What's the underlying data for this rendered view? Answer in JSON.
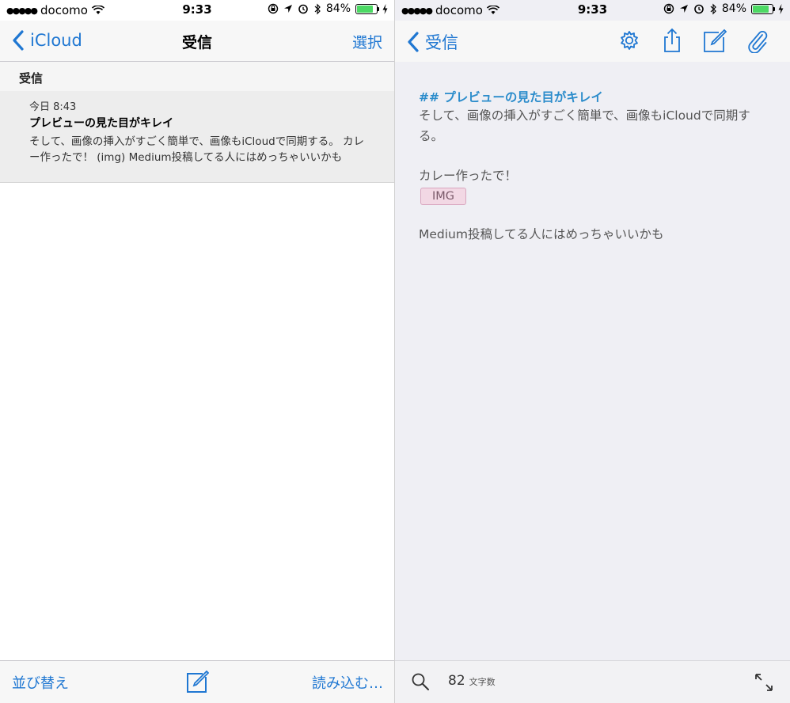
{
  "status": {
    "signal": "●●●●●",
    "carrier": "docomo",
    "time": "9:33",
    "battery": "84%",
    "battery_level": 0.84
  },
  "left": {
    "nav": {
      "back_label": "iCloud",
      "title": "受信",
      "action": "選択"
    },
    "section": "受信",
    "message": {
      "date": "今日 8:43",
      "title": "プレビューの見た目がキレイ",
      "preview": "そして、画像の挿入がすごく簡単で、画像もiCloudで同期する。 カレー作ったで！ (img) Medium投稿してる人にはめっちゃいいかも"
    },
    "bottom": {
      "sort": "並び替え",
      "load": "読み込む…"
    }
  },
  "right": {
    "nav": {
      "back_label": "受信"
    },
    "editor": {
      "heading": "## プレビューの見た目がキレイ",
      "line1": "そして、画像の挿入がすごく簡単で、画像もiCloudで同期す",
      "line2": "る。",
      "line3": "カレー作ったで！",
      "img": "IMG",
      "line4": "Medium投稿してる人にはめっちゃいいかも"
    },
    "bottom": {
      "count": "82",
      "count_label": "文字数"
    }
  },
  "colors": {
    "accent": "#1f77d2",
    "heading": "#2b8ccb",
    "battery": "#4cd964",
    "img_tag": "#f2d8e4"
  },
  "icons": [
    "wifi-icon",
    "rotation-lock-icon",
    "location-icon",
    "alarm-icon",
    "bluetooth-icon",
    "charging-icon",
    "chevron-left-icon",
    "gear-icon",
    "share-icon",
    "compose-icon",
    "paperclip-icon",
    "search-icon",
    "expand-icon"
  ]
}
